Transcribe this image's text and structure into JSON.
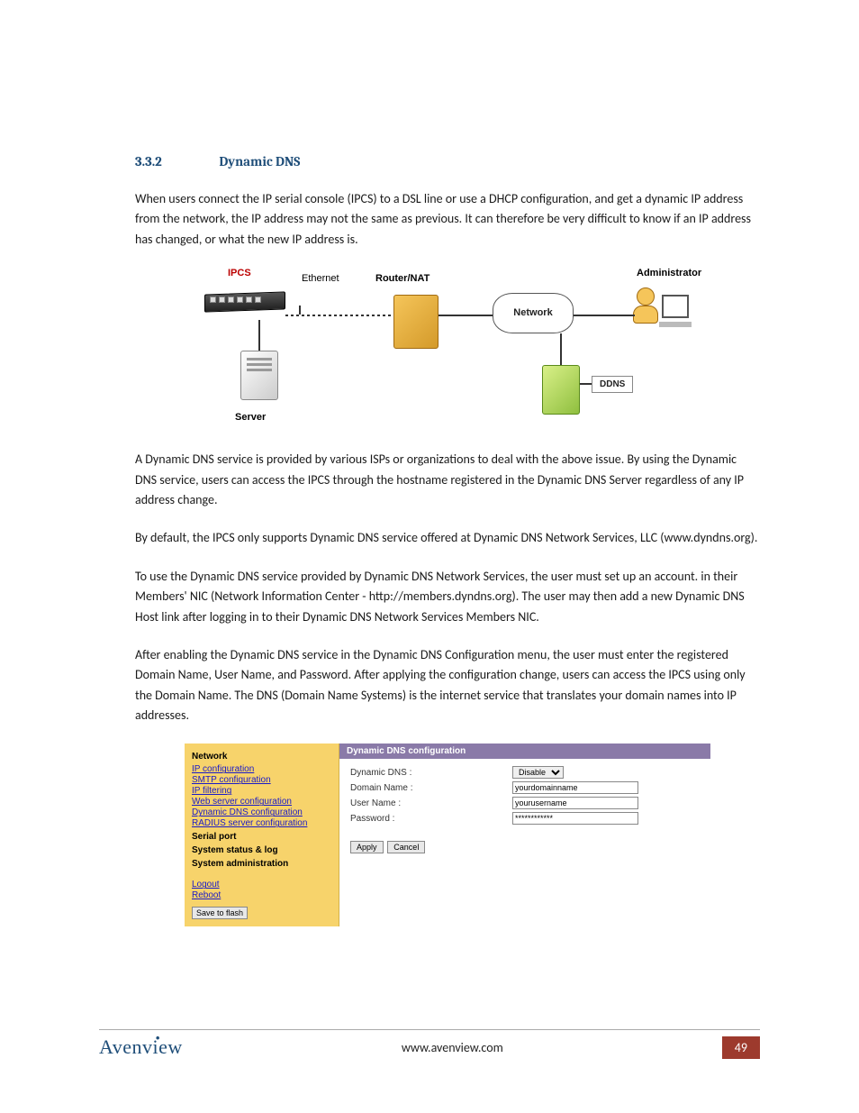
{
  "heading": {
    "number": "3.3.2",
    "title": "Dynamic DNS"
  },
  "paragraphs": {
    "p1": "When users connect the IP serial console (IPCS) to a DSL line or use a DHCP configuration, and get a dynamic IP address from the network, the IP address may not the same as previous. It can therefore be very difficult to know if an IP address has changed, or what the new IP address is.",
    "p2": "A Dynamic DNS service is provided by various ISPs or organizations to deal with the above issue. By using the Dynamic DNS service, users can access the IPCS through the hostname registered in the Dynamic DNS Server regardless of any IP address change.",
    "p3": "By default, the IPCS only supports Dynamic DNS service offered at Dynamic DNS Network Services, LLC (www.dyndns.org).",
    "p4": "To use the Dynamic DNS service provided by Dynamic DNS Network Services, the user must set up an account. in their Members' NIC (Network Information Center - http://members.dyndns.org). The user may then add a new Dynamic DNS Host link after logging in to their Dynamic DNS Network Services Members NIC.",
    "p5": "After enabling the Dynamic DNS service in the Dynamic DNS Configuration menu, the user must enter the registered Domain Name, User Name, and Password. After applying the configuration change, users can access the IPCS using only the Domain Name. The DNS (Domain Name Systems) is the internet service that translates your domain names into IP addresses."
  },
  "diagram": {
    "ipcs": "IPCS",
    "ethernet": "Ethernet",
    "router": "Router/NAT",
    "network": "Network",
    "admin": "Administrator",
    "server": "Server",
    "ddns": "DDNS"
  },
  "config": {
    "side": {
      "network_hdr": "Network",
      "links": {
        "ip": "IP configuration",
        "smtp": "SMTP configuration",
        "ipfilter": "IP filtering",
        "web": "Web server configuration",
        "ddns": "Dynamic DNS configuration",
        "radius": "RADIUS server configuration"
      },
      "serial_hdr": "Serial port",
      "status_hdr": "System status & log",
      "admin_hdr": "System administration",
      "logout": "Logout",
      "reboot": "Reboot",
      "save": "Save to flash"
    },
    "main": {
      "bar": "Dynamic DNS configuration",
      "labels": {
        "ddns": "Dynamic DNS :",
        "domain": "Domain Name :",
        "user": "User Name :",
        "pass": "Password :"
      },
      "values": {
        "ddns_select": "Disable",
        "domain": "yourdomainname",
        "user": "yourusername",
        "pass": "************"
      },
      "apply": "Apply",
      "cancel": "Cancel"
    }
  },
  "footer": {
    "logo": "Avenview",
    "url": "www.avenview.com",
    "page": "49"
  }
}
